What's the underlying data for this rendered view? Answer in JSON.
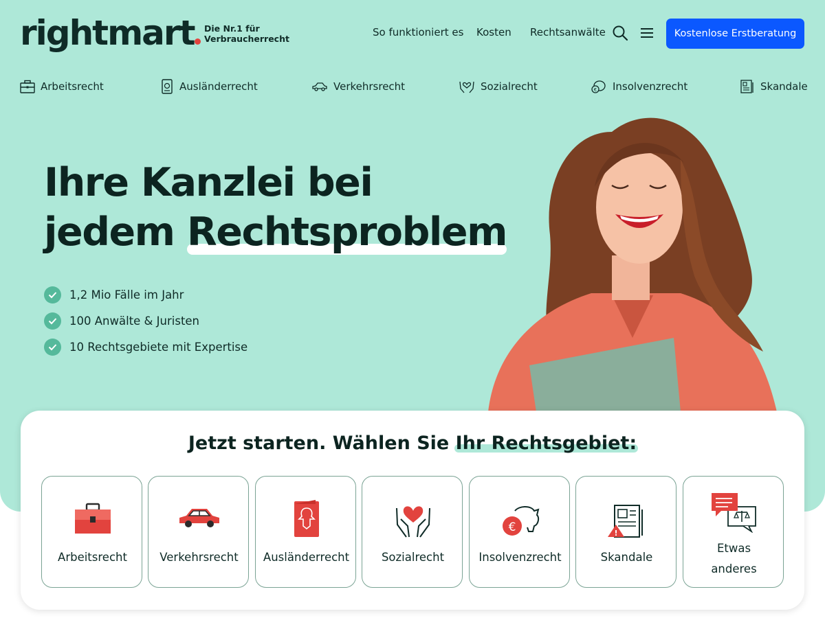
{
  "header": {
    "logo": "rightmart",
    "tagline_line1": "Die Nr.1 für",
    "tagline_line2": "Verbraucherrecht",
    "nav": [
      "So funktioniert es",
      "Kosten",
      "Rechtsanwälte"
    ],
    "search_icon": "search-icon",
    "menu_icon": "hamburger-menu-icon",
    "cta_label": "Kostenlose Erstberatung",
    "cta_color": "#0b58ff"
  },
  "category_strip": [
    {
      "label": "Arbeitsrecht",
      "icon": "briefcase-icon"
    },
    {
      "label": "Ausländerrecht",
      "icon": "passport-icon"
    },
    {
      "label": "Verkehrsrecht",
      "icon": "car-icon"
    },
    {
      "label": "Sozialrecht",
      "icon": "heart-hands-icon"
    },
    {
      "label": "Insolvenzrecht",
      "icon": "piggy-bank-icon"
    },
    {
      "label": "Skandale",
      "icon": "newspaper-icon"
    }
  ],
  "hero": {
    "headline_line1": "Ihre Kanzlei bei",
    "headline_line2_a": "jedem ",
    "headline_line2_b": "Rechtsproblem",
    "checks": [
      "1,2 Mio Fälle im Jahr",
      "100 Anwälte & Juristen",
      "10 Rechtsgebiete mit Expertise"
    ],
    "background_color": "#aee8d8"
  },
  "selector": {
    "title_a": "Jetzt starten. Wählen Sie ",
    "title_b": "Ihr Rechtsgebiet:",
    "tiles": [
      {
        "label": "Arbeitsrecht",
        "icon": "briefcase-icon"
      },
      {
        "label": "Verkehrsrecht",
        "icon": "car-icon"
      },
      {
        "label": "Ausländerrecht",
        "icon": "passport-icon"
      },
      {
        "label": "Sozialrecht",
        "icon": "heart-hands-icon"
      },
      {
        "label": "Insolvenzrecht",
        "icon": "piggy-bank-euro-icon"
      },
      {
        "label": "Skandale",
        "icon": "newspaper-warning-icon"
      },
      {
        "label_line1": "Etwas",
        "label_line2": "anderes",
        "icon": "chat-scales-icon"
      }
    ],
    "accent_color": "#e2433e"
  }
}
